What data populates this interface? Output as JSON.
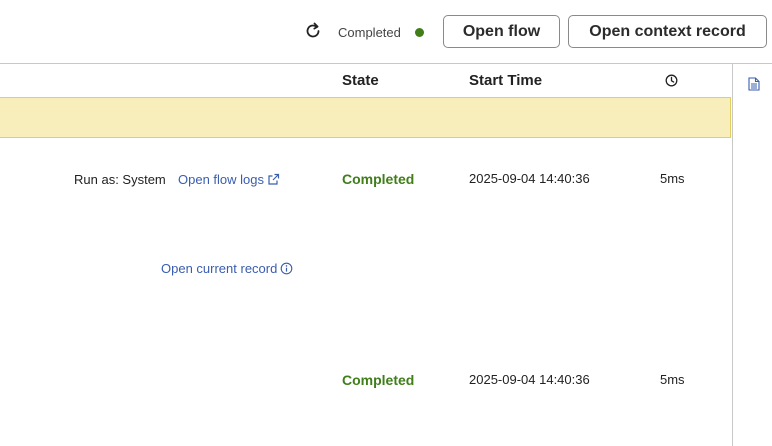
{
  "header": {
    "refresh_icon": "refresh-icon",
    "status_label": "Completed",
    "status_color": "#3f7e19",
    "open_flow_label": "Open flow",
    "open_context_label": "Open context record"
  },
  "table": {
    "columns": {
      "state": "State",
      "start_time": "Start Time",
      "duration_icon": "clock-icon"
    },
    "rows": [
      {
        "run_as": "Run as: System",
        "link_label": "Open flow logs",
        "link_icon": "external-link-icon",
        "state": "Completed",
        "start_time": "2025-09-04 14:40:36",
        "duration": "5ms"
      },
      {
        "link_label": "Open current record",
        "link_icon": "info-icon"
      },
      {
        "state": "Completed",
        "start_time": "2025-09-04 14:40:36",
        "duration": "5ms"
      }
    ],
    "highlight_color": "#f8eebb"
  },
  "sidepanel": {
    "icon": "document-icon"
  }
}
